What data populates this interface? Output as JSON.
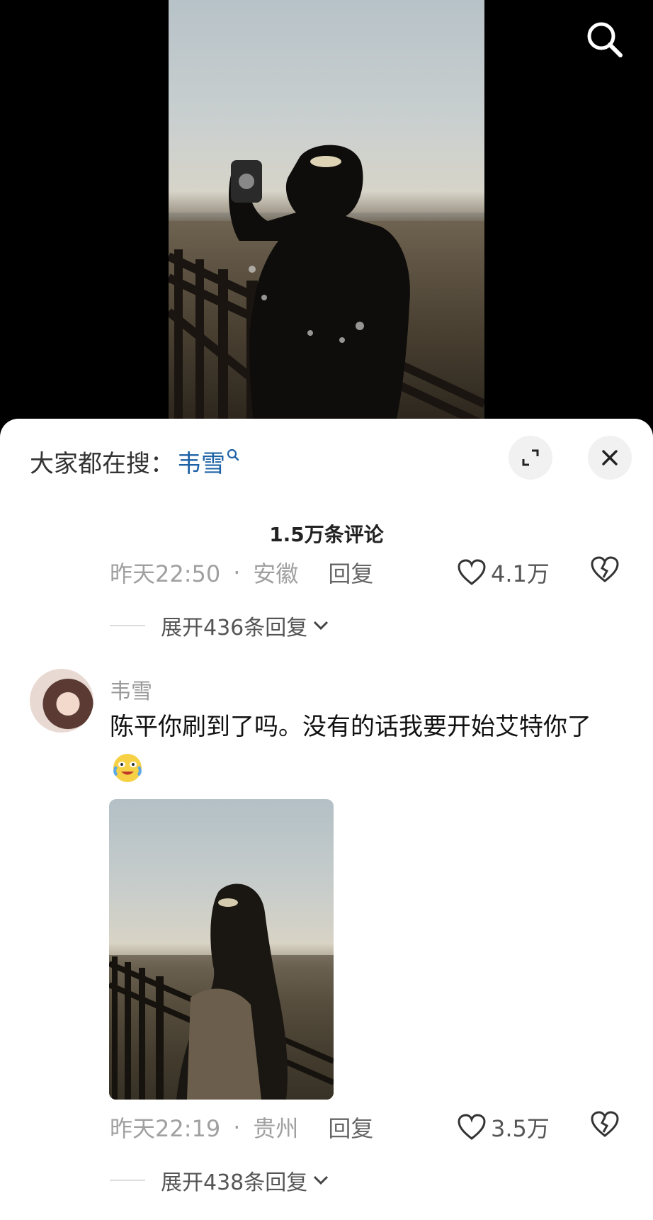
{
  "search_hint": {
    "prefix": "大家都在搜：",
    "term": "韦雪"
  },
  "comments_header": {
    "count_label": "1.5万条评论"
  },
  "comment1": {
    "time": "昨天22:50",
    "separator": "·",
    "location": "安徽",
    "reply_label": "回复",
    "likes": "4.1万",
    "expand_label": "展开436条回复"
  },
  "comment2": {
    "username": "韦雪",
    "text": "陈平你刷到了吗。没有的话我要开始艾特你了",
    "emoji": "crying-laughing-emoji",
    "time": "昨天22:19",
    "separator": "·",
    "location": "贵州",
    "reply_label": "回复",
    "likes": "3.5万",
    "expand_label": "展开438条回复"
  },
  "icons": {
    "top_search": "search-icon",
    "expand": "expand-icon",
    "close": "close-icon",
    "like": "heart-icon",
    "dislike": "broken-heart-icon",
    "chevron": "chevron-down-icon"
  },
  "colors": {
    "search_term": "#1e62a6",
    "meta_text": "#a0a0a0",
    "sheet_bg": "#ffffff",
    "page_bg": "#000000"
  }
}
